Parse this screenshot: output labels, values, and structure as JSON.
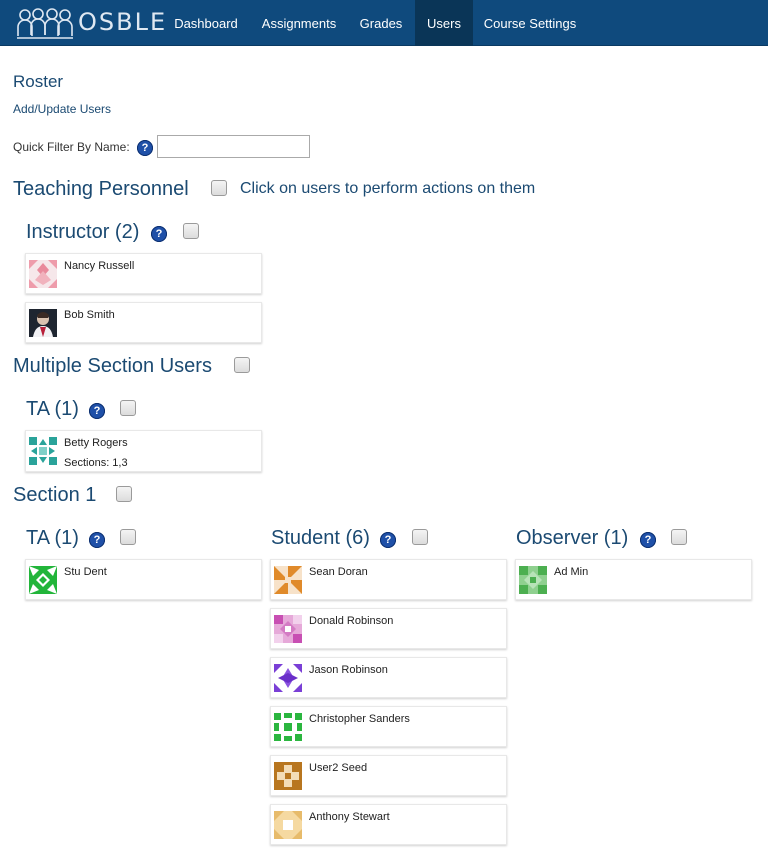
{
  "app": {
    "logo_text": "OSBLE"
  },
  "nav": [
    {
      "label": "Dashboard"
    },
    {
      "label": "Assignments"
    },
    {
      "label": "Grades"
    },
    {
      "label": "Users",
      "active": true
    },
    {
      "label": "Course Settings"
    }
  ],
  "page": {
    "title": "Roster",
    "add_link": "Add/Update Users",
    "filter_label": "Quick Filter By Name:",
    "filter_value": "",
    "help_glyph": "?"
  },
  "teaching": {
    "heading": "Teaching Personnel",
    "hint": "Click on users to perform actions on them",
    "instructor_heading": "Instructor (2)",
    "instructors": [
      {
        "name": "Nancy Russell",
        "avatar": "pink-quilt-icon"
      },
      {
        "name": "Bob Smith",
        "avatar": "photo-icon"
      }
    ]
  },
  "multi": {
    "heading": "Multiple Section Users",
    "ta_heading": "TA (1)",
    "tas": [
      {
        "name": "Betty Rogers",
        "sections": "Sections: 1,3",
        "avatar": "teal-quilt-icon"
      }
    ]
  },
  "section1": {
    "heading": "Section 1",
    "ta_heading": "TA (1)",
    "tas": [
      {
        "name": "Stu Dent",
        "avatar": "green-quilt-icon"
      }
    ],
    "student_heading": "Student (6)",
    "students": [
      {
        "name": "Sean Doran",
        "avatar": "orange-quilt-icon"
      },
      {
        "name": "Donald Robinson",
        "avatar": "magenta-quilt-icon"
      },
      {
        "name": "Jason Robinson",
        "avatar": "purple-quilt-icon"
      },
      {
        "name": "Christopher Sanders",
        "avatar": "green-quilt-icon"
      },
      {
        "name": "User2 Seed",
        "avatar": "brown-quilt-icon"
      },
      {
        "name": "Anthony Stewart",
        "avatar": "tan-quilt-icon"
      }
    ],
    "observer_heading": "Observer (1)",
    "observers": [
      {
        "name": "Ad Min",
        "avatar": "lightgreen-quilt-icon"
      }
    ]
  },
  "colors": {
    "navbar": "#0f4a7d",
    "heading": "#1b4a72",
    "help": "#1f50a8"
  }
}
